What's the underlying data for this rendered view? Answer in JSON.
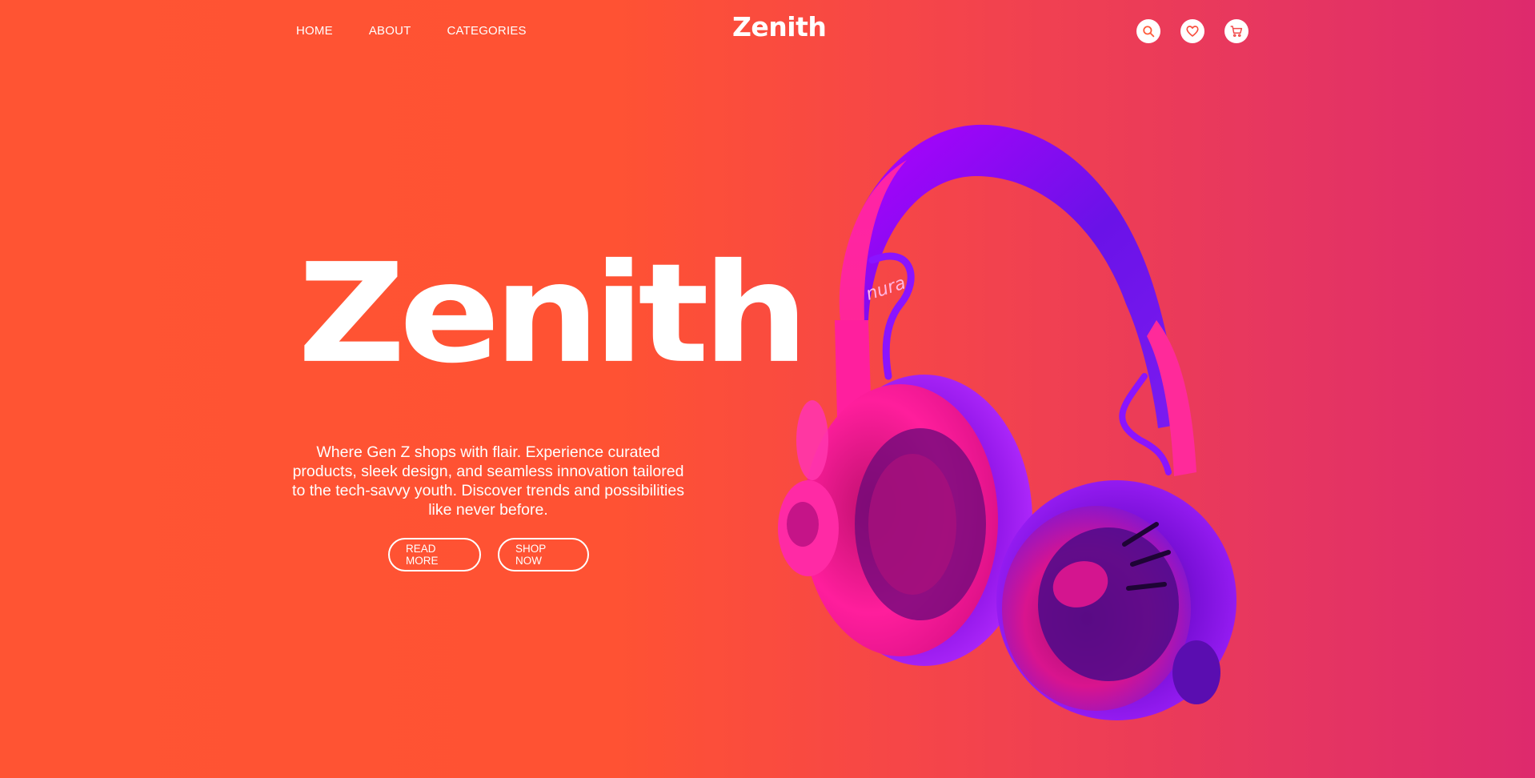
{
  "nav": {
    "links": [
      {
        "label": "HOME"
      },
      {
        "label": "ABOUT"
      },
      {
        "label": "CATEGORIES"
      }
    ],
    "logo": "Zenith",
    "icons": [
      "search-icon",
      "heart-icon",
      "cart-icon"
    ]
  },
  "hero": {
    "title": "Zenith",
    "description": "Where Gen Z shops with flair. Experience curated products, sleek design, and seamless innovation tailored to the tech-savvy youth. Discover trends and possibilities like never before.",
    "buttons": {
      "read_more": "READ MORE",
      "shop_now": "SHOP NOW"
    },
    "product_brand": "nura"
  },
  "colors": {
    "background_start": "#ff5433",
    "background_end": "#de2a6d",
    "text": "#ffffff",
    "headphone_pink": "#ff1aa0",
    "headphone_purple": "#8a14ff"
  }
}
